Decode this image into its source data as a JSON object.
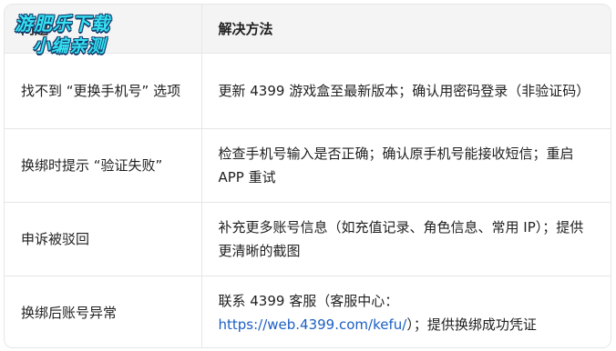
{
  "table": {
    "headers": [
      "问题",
      "解决方法"
    ],
    "rows": [
      {
        "problem": "找不到 “更换手机号” 选项",
        "solution": "更新 4399 游戏盒至最新版本；确认用密码登录（非验证码）"
      },
      {
        "problem": "换绑时提示 “验证失败”",
        "solution": "检查手机号输入是否正确；确认原手机号能接收短信；重启 APP 重试"
      },
      {
        "problem": "申诉被驳回",
        "solution": "补充更多账号信息（如充值记录、角色信息、常用 IP）；提供更清晰的截图"
      },
      {
        "problem": "换绑后账号异常",
        "solution_prefix": "联系 4399 客服（客服中心：",
        "solution_link": "https://web.4399.com/kefu/",
        "solution_suffix": "）；提供换绑成功凭证"
      }
    ]
  },
  "watermark": {
    "line1": "游肥乐下载",
    "line2": "小编亲测"
  },
  "colors": {
    "header_bg": "#f4f4f4",
    "border": "#e6e6e6",
    "link": "#1a5fc4",
    "watermark_fill": "#35e0f0",
    "watermark_outline": "#123a6b"
  }
}
